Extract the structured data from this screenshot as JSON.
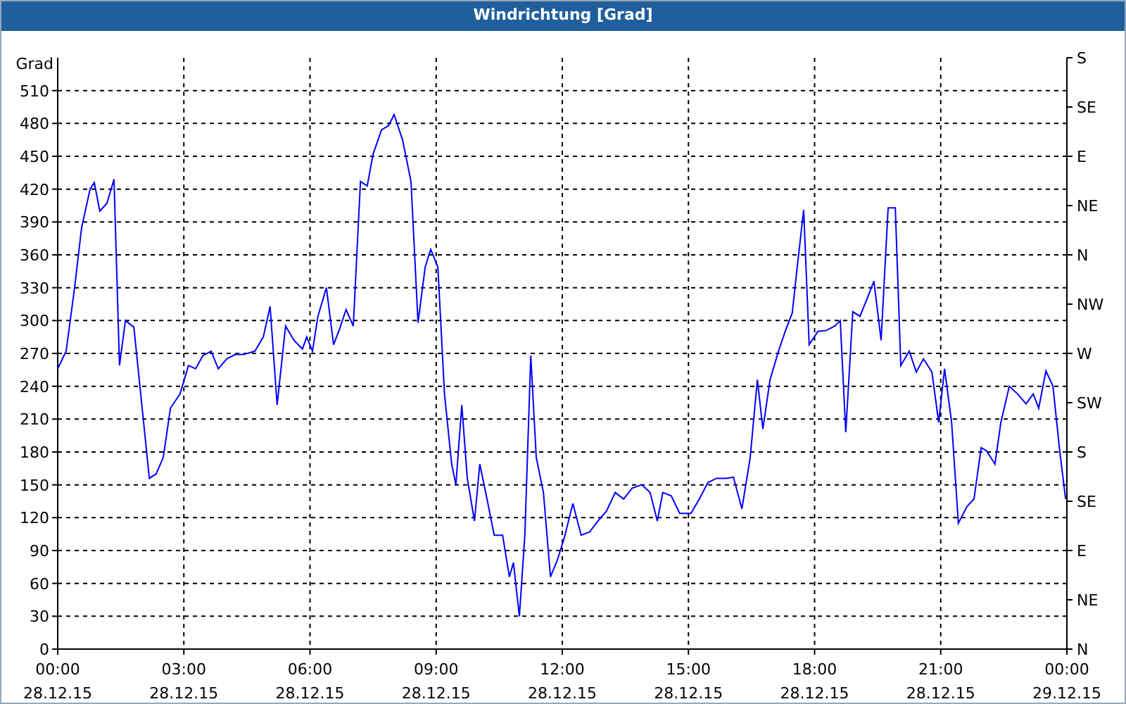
{
  "window": {
    "title": "Windrichtung [Grad]"
  },
  "chart": {
    "chart_data": {
      "type": "line",
      "grid": true,
      "ylabel": "Grad",
      "xlim": [
        0,
        24
      ],
      "ylim": [
        0,
        540
      ],
      "xticks": [
        {
          "value": 0,
          "label": "00:00"
        },
        {
          "value": 3,
          "label": "03:00"
        },
        {
          "value": 6,
          "label": "06:00"
        },
        {
          "value": 9,
          "label": "09:00"
        },
        {
          "value": 12,
          "label": "12:00"
        },
        {
          "value": 15,
          "label": "15:00"
        },
        {
          "value": 18,
          "label": "18:00"
        },
        {
          "value": 21,
          "label": "21:00"
        },
        {
          "value": 24,
          "label": "00:00"
        }
      ],
      "yticks": [
        0,
        30,
        60,
        90,
        120,
        150,
        180,
        210,
        240,
        270,
        300,
        330,
        360,
        390,
        420,
        450,
        480,
        510
      ],
      "x": [
        0,
        0.2,
        0.4,
        0.57,
        0.77,
        0.87,
        1.0,
        1.17,
        1.34,
        1.47,
        1.61,
        1.81,
        2.01,
        2.18,
        2.34,
        2.51,
        2.68,
        2.91,
        3.11,
        3.28,
        3.45,
        3.65,
        3.82,
        4.02,
        4.22,
        4.42,
        4.69,
        4.89,
        5.05,
        5.22,
        5.42,
        5.62,
        5.82,
        5.92,
        6.06,
        6.19,
        6.39,
        6.56,
        6.69,
        6.86,
        7.03,
        7.2,
        7.36,
        7.5,
        7.7,
        7.87,
        8.0,
        8.2,
        8.4,
        8.57,
        8.74,
        8.87,
        9.04,
        9.2,
        9.37,
        9.47,
        9.61,
        9.74,
        9.91,
        10.04,
        10.21,
        10.38,
        10.58,
        10.74,
        10.84,
        10.98,
        11.11,
        11.25,
        11.38,
        11.55,
        11.72,
        11.88,
        12.05,
        12.25,
        12.45,
        12.65,
        12.85,
        13.05,
        13.26,
        13.46,
        13.66,
        13.89,
        14.09,
        14.26,
        14.39,
        14.59,
        14.79,
        15.06,
        15.26,
        15.46,
        15.67,
        15.9,
        16.07,
        16.27,
        16.47,
        16.64,
        16.77,
        16.94,
        17.14,
        17.31,
        17.47,
        17.57,
        17.74,
        17.87,
        18.08,
        18.28,
        18.48,
        18.61,
        18.74,
        18.91,
        19.08,
        19.25,
        19.41,
        19.58,
        19.75,
        19.92,
        20.05,
        20.25,
        20.42,
        20.59,
        20.79,
        20.95,
        21.09,
        21.26,
        21.42,
        21.62,
        21.79,
        21.96,
        22.09,
        22.29,
        22.43,
        22.63,
        22.83,
        23.03,
        23.2,
        23.33,
        23.5,
        23.67,
        23.83,
        23.97
      ],
      "series": [
        {
          "color": "#0000ff",
          "values": [
            256,
            272,
            330,
            385,
            420,
            426,
            400,
            407,
            429,
            259,
            300,
            294,
            220,
            156,
            160,
            175,
            220,
            233,
            259,
            256,
            268,
            272,
            256,
            265,
            269,
            269,
            272,
            285,
            313,
            223,
            295,
            282,
            274,
            285,
            272,
            304,
            330,
            278,
            291,
            310,
            295,
            427,
            423,
            452,
            474,
            478,
            488,
            465,
            427,
            298,
            349,
            365,
            349,
            233,
            169,
            150,
            223,
            156,
            117,
            169,
            137,
            104,
            104,
            66,
            79,
            30,
            104,
            268,
            175,
            143,
            66,
            81,
            102,
            133,
            104,
            107,
            117,
            126,
            143,
            137,
            147,
            150,
            143,
            117,
            143,
            140,
            124,
            124,
            137,
            152,
            156,
            156,
            157,
            128,
            175,
            246,
            201,
            246,
            272,
            291,
            307,
            343,
            401,
            278,
            290,
            291,
            295,
            300,
            198,
            308,
            304,
            320,
            336,
            282,
            403,
            403,
            259,
            272,
            253,
            265,
            253,
            207,
            256,
            207,
            115,
            130,
            137,
            184,
            181,
            169,
            207,
            240,
            233,
            224,
            233,
            220,
            254,
            240,
            181,
            137
          ]
        }
      ]
    },
    "x_dates": [
      "28.12.15",
      "28.12.15",
      "28.12.15",
      "28.12.15",
      "28.12.15",
      "28.12.15",
      "28.12.15",
      "28.12.15",
      "29.12.15"
    ],
    "direction_labels": [
      "S",
      "SE",
      "E",
      "NE",
      "N",
      "NW",
      "W",
      "SW",
      "S",
      "SE",
      "E",
      "NE",
      "N"
    ]
  }
}
